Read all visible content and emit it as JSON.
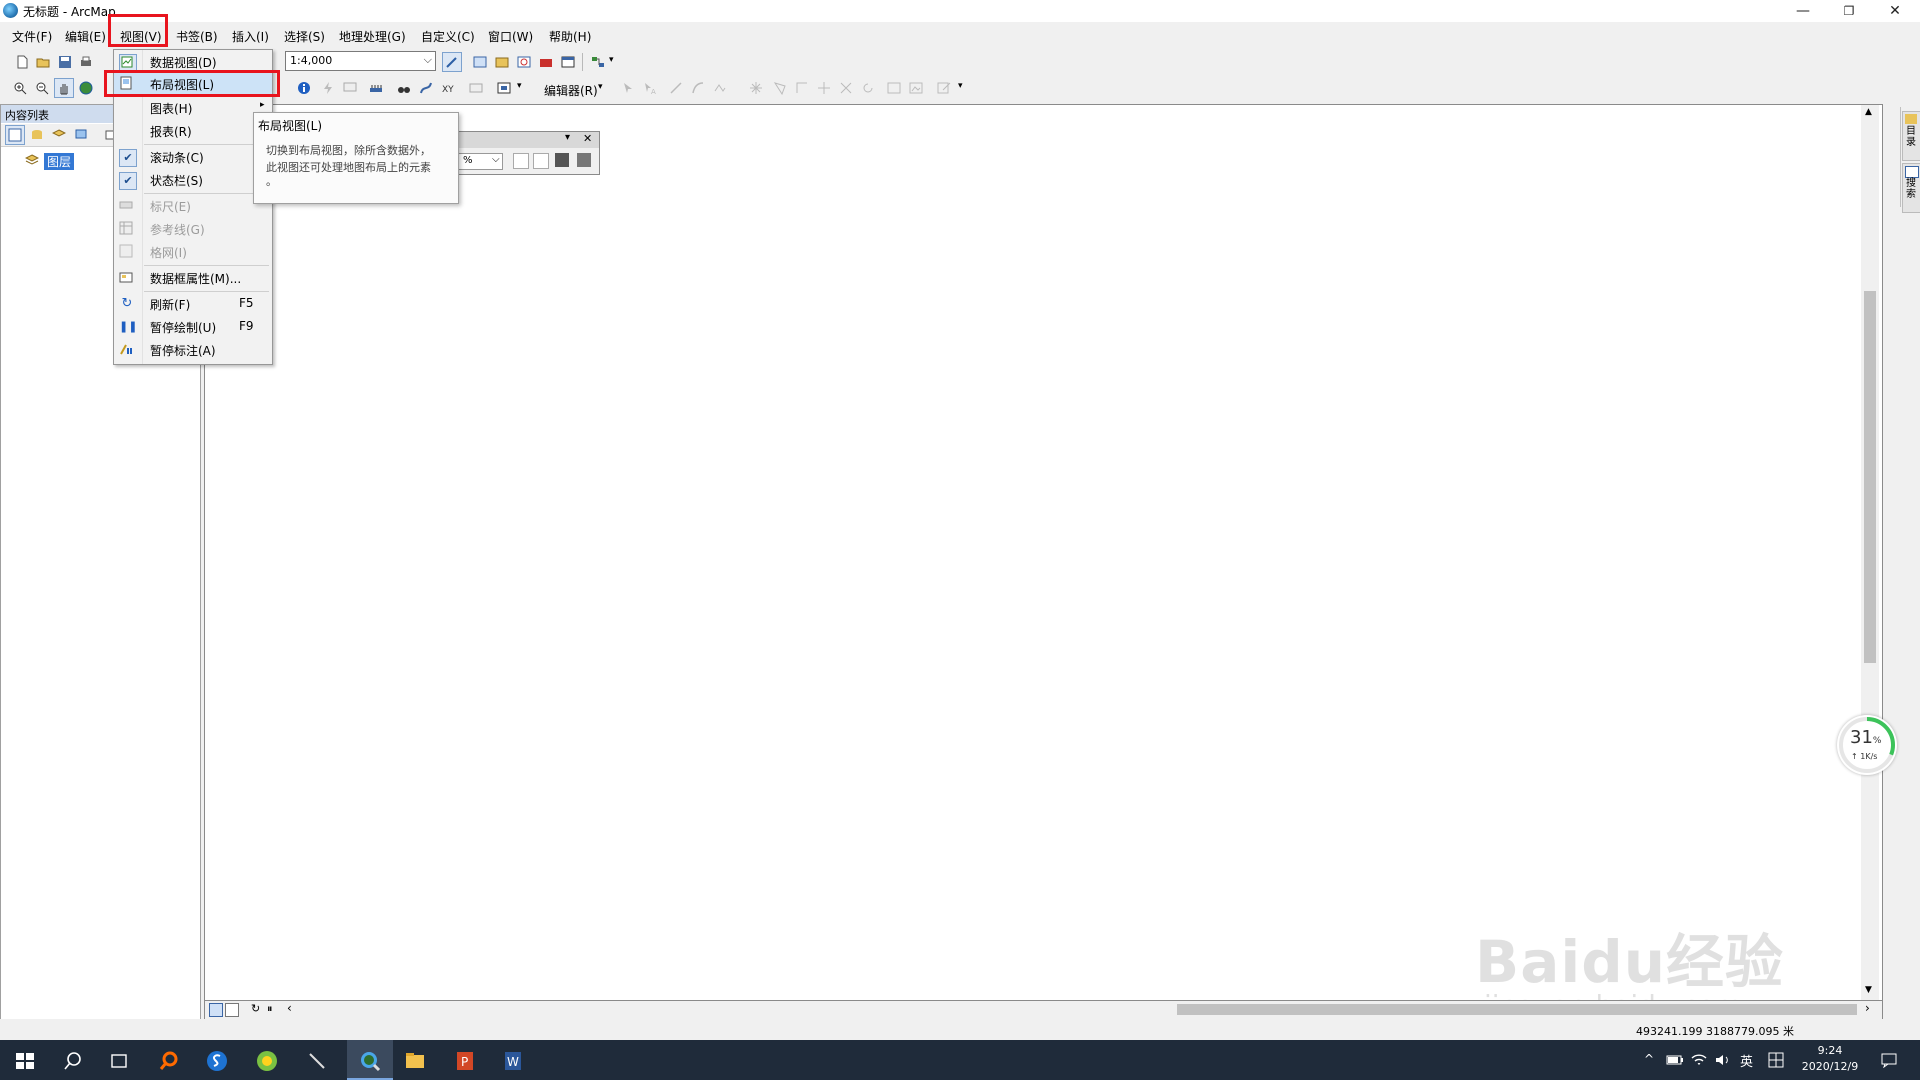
{
  "window": {
    "title": "无标题 - ArcMap"
  },
  "menubar": [
    "文件(F)",
    "编辑(E)",
    "视图(V)",
    "书签(B)",
    "插入(I)",
    "选择(S)",
    "地理处理(G)",
    "自定义(C)",
    "窗口(W)",
    "帮助(H)"
  ],
  "toolbar": {
    "scale": "1:4,000",
    "editor": "编辑器(R)"
  },
  "toc": {
    "title": "内容列表",
    "layer": "图层"
  },
  "view_menu": {
    "items": [
      {
        "label": "数据视图(D)",
        "shortcut": ""
      },
      {
        "label": "布局视图(L)",
        "shortcut": ""
      },
      {
        "label": "图表(H)",
        "shortcut": ""
      },
      {
        "label": "报表(R)",
        "shortcut": ""
      },
      {
        "label": "滚动条(C)",
        "shortcut": ""
      },
      {
        "label": "状态栏(S)",
        "shortcut": ""
      },
      {
        "label": "标尺(E)",
        "shortcut": ""
      },
      {
        "label": "参考线(G)",
        "shortcut": ""
      },
      {
        "label": "格网(I)",
        "shortcut": ""
      },
      {
        "label": "数据框属性(M)...",
        "shortcut": ""
      },
      {
        "label": "刷新(F)",
        "shortcut": "F5"
      },
      {
        "label": "暂停绘制(U)",
        "shortcut": "F9"
      },
      {
        "label": "暂停标注(A)",
        "shortcut": ""
      }
    ]
  },
  "tooltip": {
    "title": "布局视图(L)",
    "line1": "切换到布局视图，除所含数据外，",
    "line2": "此视图还可处理地图布局上的元素",
    "line3": "。"
  },
  "floatwin": {
    "zoom": "%"
  },
  "statusbar": {
    "coords": "493241.199  3188779.095 米"
  },
  "right_tabs": [
    "目录",
    "搜索"
  ],
  "net": {
    "percent": "31",
    "unit": "%",
    "speed": "1K/s"
  },
  "tray": {
    "ime": "英",
    "time": "9:24",
    "date": "2020/12/9"
  },
  "watermark": {
    "brand": "Baidu经验",
    "url": "jingyan.baidu.com"
  },
  "colors": {
    "highlight": "#e8141e",
    "menu_hover": "#cde3f7",
    "taskbar": "#1f2b3a"
  }
}
